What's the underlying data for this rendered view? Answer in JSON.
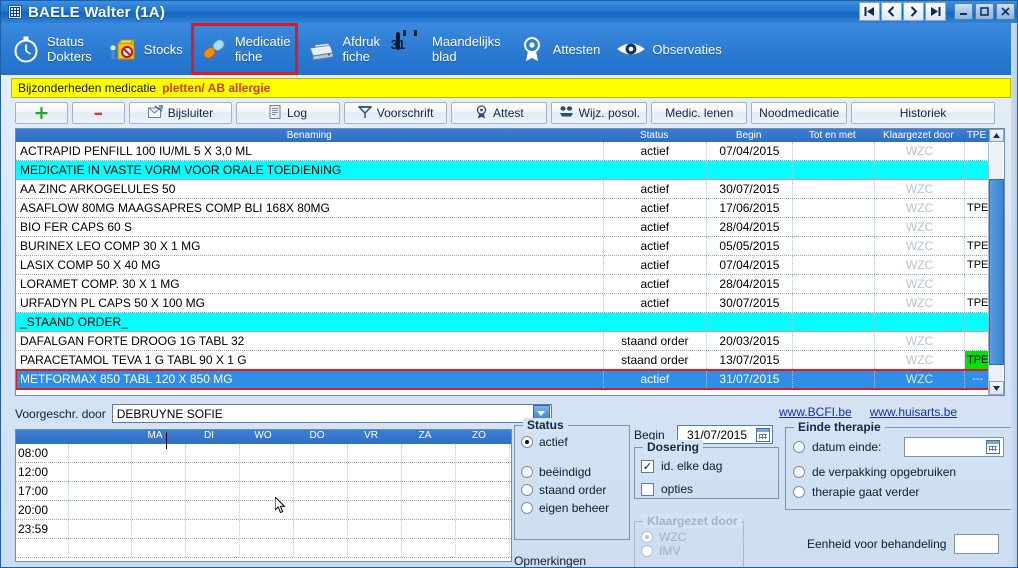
{
  "window": {
    "title": "BAELE Walter (1A)",
    "grip_icon": "grid-icon",
    "nav": [
      {
        "name": "first-record-button",
        "glyph": "|<"
      },
      {
        "name": "previous-record-button",
        "glyph": "<"
      },
      {
        "name": "next-record-button",
        "glyph": ">"
      },
      {
        "name": "last-record-button",
        "glyph": ">|"
      }
    ],
    "controls": [
      {
        "name": "minimize-button",
        "glyph": "–"
      },
      {
        "name": "maximize-button",
        "glyph": "▭"
      },
      {
        "name": "close-button",
        "glyph": "✕"
      }
    ]
  },
  "toolbar": {
    "items": [
      {
        "icon": "stopwatch-icon",
        "line1": "Status",
        "line2": "Dokters",
        "selected": false
      },
      {
        "icon": "stock-box-icon",
        "line1": "Stocks",
        "line2": "",
        "selected": false
      },
      {
        "icon": "pill-capsule-icon",
        "line1": "Medicatie",
        "line2": "fiche",
        "selected": true
      },
      {
        "icon": "printer-icon",
        "line1": "Afdruk",
        "line2": "fiche",
        "selected": false
      },
      {
        "icon": "calendar-31-icon",
        "line1": "Maandelijks",
        "line2": "blad",
        "selected": false
      },
      {
        "icon": "award-rosette-icon",
        "line1": "Attesten",
        "line2": "",
        "selected": false
      },
      {
        "icon": "eye-icon",
        "line1": "Observaties",
        "line2": "",
        "selected": false
      }
    ]
  },
  "notice": {
    "label": "Bijzonderheden medicatie",
    "value": "pletten/ AB allergie",
    "background": "#ffff00",
    "value_color": "#d43a00"
  },
  "actions": [
    {
      "name": "add-button",
      "label": "",
      "icon": "plus-icon",
      "width": "plus"
    },
    {
      "name": "remove-button",
      "label": "",
      "icon": "minus-icon",
      "width": "minus"
    },
    {
      "name": "bijsluiter-button",
      "label": "Bijsluiter",
      "icon": "leaflet-icon",
      "width": "w110"
    },
    {
      "name": "log-button",
      "label": "Log",
      "icon": "document-icon",
      "width": "w110"
    },
    {
      "name": "voorschrift-button",
      "label": "Voorschrift",
      "icon": "prescription-icon",
      "width": "w110"
    },
    {
      "name": "attest-button",
      "label": "Attest",
      "icon": "award-rosette-icon",
      "width": "w100"
    },
    {
      "name": "wijz-posol-button",
      "label": "Wijz. posol.",
      "icon": "edit-dose-icon",
      "width": "w100"
    },
    {
      "name": "medic-lenen-button",
      "label": "Medic. lenen",
      "icon": "",
      "width": "w100"
    },
    {
      "name": "noodmedicatie-button",
      "label": "Noodmedicatie",
      "icon": "",
      "width": "w100"
    }
  ],
  "historiek_button": "Historiek",
  "table": {
    "columns": [
      "Benaming",
      "Status",
      "Begin",
      "Tot en met",
      "Klaargezet door",
      "TPE"
    ],
    "rows": [
      {
        "benaming": "ACTRAPID PENFILL 100 IU/ML 5 X 3,0 ML",
        "status": "actief",
        "begin": "07/04/2015",
        "tot": "",
        "klaar": "WZC",
        "tpe": "",
        "kind": "normal"
      },
      {
        "benaming": "MEDICATIE  IN VASTE VORM VOOR ORALE TOEDIENING",
        "status": "",
        "begin": "",
        "tot": "",
        "klaar": "",
        "tpe": "",
        "kind": "section"
      },
      {
        "benaming": "AA ZINC ARKOGELULES 50",
        "status": "actief",
        "begin": "30/07/2015",
        "tot": "",
        "klaar": "WZC",
        "tpe": "",
        "kind": "normal"
      },
      {
        "benaming": "ASAFLOW  80MG MAAGSAPRES COMP BLI 168X 80MG",
        "status": "actief",
        "begin": "17/06/2015",
        "tot": "",
        "klaar": "WZC",
        "tpe": "TPE",
        "kind": "normal"
      },
      {
        "benaming": "BIO FER CAPS  60                    S",
        "status": "actief",
        "begin": "28/04/2015",
        "tot": "",
        "klaar": "WZC",
        "tpe": "",
        "kind": "normal"
      },
      {
        "benaming": "BURINEX LEO COMP  30 X 1 MG",
        "status": "actief",
        "begin": "05/05/2015",
        "tot": "",
        "klaar": "WZC",
        "tpe": "TPE",
        "kind": "normal"
      },
      {
        "benaming": "LASIX COMP  50 X 40 MG",
        "status": "actief",
        "begin": "07/04/2015",
        "tot": "",
        "klaar": "WZC",
        "tpe": "TPE",
        "kind": "normal"
      },
      {
        "benaming": "LORAMET COMP. 30 X 1 MG",
        "status": "actief",
        "begin": "28/04/2015",
        "tot": "",
        "klaar": "WZC",
        "tpe": "",
        "kind": "normal"
      },
      {
        "benaming": "URFADYN PL CAPS  50 X 100 MG",
        "status": "actief",
        "begin": "30/07/2015",
        "tot": "",
        "klaar": "WZC",
        "tpe": "TPE",
        "kind": "normal"
      },
      {
        "benaming": "_STAAND ORDER_",
        "status": "",
        "begin": "",
        "tot": "",
        "klaar": "",
        "tpe": "",
        "kind": "section"
      },
      {
        "benaming": "DAFALGAN FORTE DROOG 1G TABL 32",
        "status": "staand order",
        "begin": "20/03/2015",
        "tot": "",
        "klaar": "WZC",
        "tpe": "",
        "kind": "normal"
      },
      {
        "benaming": "PARACETAMOL TEVA 1 G TABL  90 X 1 G",
        "status": "staand order",
        "begin": "13/07/2015",
        "tot": "",
        "klaar": "WZC",
        "tpe": "TPE",
        "kind": "normal",
        "tpe_highlight": "#00e000"
      },
      {
        "benaming": "METFORMAX 850 TABL 120 X 850 MG",
        "status": "actief",
        "begin": "31/07/2015",
        "tot": "",
        "klaar": "WZC",
        "tpe": "---",
        "kind": "selected"
      }
    ]
  },
  "prescriber": {
    "label": "Voorgeschr. door",
    "value": "DEBRUYNE SOFIE"
  },
  "links": [
    {
      "name": "bcfi-link",
      "label": "www.BCFI.be"
    },
    {
      "name": "huisarts-link",
      "label": "www.huisarts.be"
    }
  ],
  "schedule": {
    "days": [
      "MA",
      "DI",
      "WO",
      "DO",
      "VR",
      "ZA",
      "ZO"
    ],
    "times": [
      "08:00",
      "12:00",
      "17:00",
      "20:00",
      "23:59",
      ""
    ]
  },
  "status_group": {
    "title": "Status",
    "options": [
      {
        "label": "actief",
        "selected": true
      },
      {
        "label": "beë indigd",
        "selected": false
      },
      {
        "label": "staand order",
        "selected": false
      },
      {
        "label": "eigen beheer",
        "selected": false
      }
    ]
  },
  "status_options_text": [
    "actief",
    "beëindigd",
    "staand order",
    "eigen beheer"
  ],
  "opmerkingen_label": "Opmerkingen",
  "begin_field": {
    "label": "Begin",
    "value": "31/07/2015",
    "icon": "calendar-picker-icon"
  },
  "dosering_group": {
    "title": "Dosering",
    "checkboxes": [
      {
        "label": "id. elke dag",
        "checked": true
      },
      {
        "label": "opties",
        "checked": false
      }
    ]
  },
  "klaargezet_group": {
    "title": "Klaargezet door",
    "disabled": true,
    "options": [
      {
        "label": "WZC",
        "selected": true
      },
      {
        "label": "IMV",
        "selected": false
      }
    ]
  },
  "einde_group": {
    "title": "Einde therapie",
    "options": [
      {
        "label": "datum einde:",
        "selected": false,
        "has_date": true,
        "date_value": ""
      },
      {
        "label": "de verpakking opgebruiken",
        "selected": false,
        "has_date": false
      },
      {
        "label": "therapie gaat verder",
        "selected": true,
        "has_date": false
      }
    ]
  },
  "eenheid": {
    "label": "Eenheid voor behandeling",
    "value": ""
  },
  "colors": {
    "accent": "#2272cc",
    "section_row": "#00ffff",
    "selected_row": "#2f8fe8",
    "marker": "#e01b1b",
    "tpe_green": "#00e000",
    "link": "#1a2ea8"
  }
}
